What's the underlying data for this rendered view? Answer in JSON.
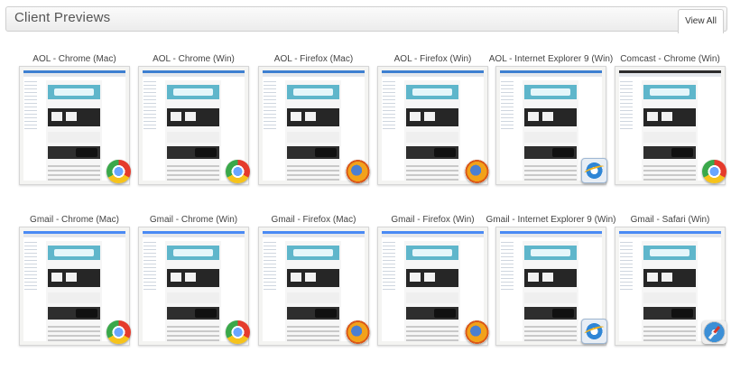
{
  "header": {
    "title": "Client Previews",
    "view_all_label": "View All"
  },
  "clients": [
    {
      "label": "AOL - Chrome (Mac)",
      "browser_icon": "chrome-icon",
      "client": "aol"
    },
    {
      "label": "AOL - Chrome (Win)",
      "browser_icon": "chrome-icon",
      "client": "aol"
    },
    {
      "label": "AOL - Firefox (Mac)",
      "browser_icon": "firefox-icon",
      "client": "aol"
    },
    {
      "label": "AOL - Firefox (Win)",
      "browser_icon": "firefox-icon",
      "client": "aol"
    },
    {
      "label": "AOL - Internet Explorer 9 (Win)",
      "browser_icon": "internet-explorer-icon",
      "client": "aol"
    },
    {
      "label": "Comcast - Chrome (Win)",
      "browser_icon": "chrome-icon",
      "client": "comcast"
    },
    {
      "label": "Gmail - Chrome (Mac)",
      "browser_icon": "chrome-icon",
      "client": "gmail"
    },
    {
      "label": "Gmail - Chrome (Win)",
      "browser_icon": "chrome-icon",
      "client": "gmail"
    },
    {
      "label": "Gmail - Firefox (Mac)",
      "browser_icon": "firefox-icon",
      "client": "gmail"
    },
    {
      "label": "Gmail - Firefox (Win)",
      "browser_icon": "firefox-icon",
      "client": "gmail"
    },
    {
      "label": "Gmail - Internet Explorer 9 (Win)",
      "browser_icon": "internet-explorer-icon",
      "client": "gmail"
    },
    {
      "label": "Gmail - Safari (Win)",
      "browser_icon": "safari-icon",
      "client": "gmail"
    }
  ],
  "colors": {
    "aol_bar": "#3d7fd1",
    "comcast_bar": "#2c2c2c",
    "gmail_bar": "#4a8af4",
    "hero_teal": "#5fb6cb"
  }
}
